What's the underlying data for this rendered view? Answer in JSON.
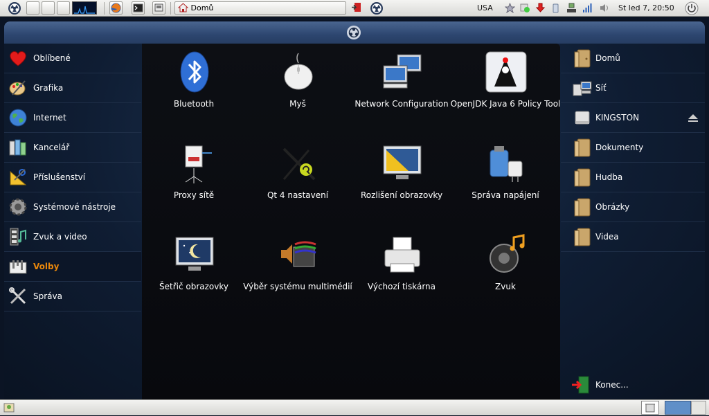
{
  "top_panel": {
    "taskbar_window": "Domů",
    "keyboard_layout": "USA",
    "clock": "St led  7, 20:50"
  },
  "categories": [
    {
      "label": "Oblíbené",
      "icon": "heart-icon"
    },
    {
      "label": "Grafika",
      "icon": "palette-icon"
    },
    {
      "label": "Internet",
      "icon": "globe-icon"
    },
    {
      "label": "Kancelář",
      "icon": "office-icon"
    },
    {
      "label": "Příslušenství",
      "icon": "accessories-icon"
    },
    {
      "label": "Systémové nástroje",
      "icon": "gear-icon"
    },
    {
      "label": "Zvuk a video",
      "icon": "multimedia-icon"
    },
    {
      "label": "Volby",
      "icon": "preferences-icon",
      "active": true
    },
    {
      "label": "Správa",
      "icon": "tools-icon"
    }
  ],
  "apps": [
    {
      "label": "Bluetooth",
      "icon": "bluetooth-icon"
    },
    {
      "label": "Myš",
      "icon": "mouse-icon"
    },
    {
      "label": "Network Configuration",
      "icon": "network-icon"
    },
    {
      "label": "OpenJDK Java 6 Policy Tool",
      "icon": "java-icon"
    },
    {
      "label": "Proxy sítě",
      "icon": "proxy-icon"
    },
    {
      "label": "Qt 4 nastavení",
      "icon": "qt-settings-icon"
    },
    {
      "label": "Rozlišení obrazovky",
      "icon": "display-resolution-icon"
    },
    {
      "label": "Správa napájení",
      "icon": "power-management-icon"
    },
    {
      "label": "Šetřič obrazovky",
      "icon": "screensaver-icon"
    },
    {
      "label": "Výběr systému multimédií",
      "icon": "multimedia-selector-icon"
    },
    {
      "label": "Výchozí tiskárna",
      "icon": "printer-icon"
    },
    {
      "label": "Zvuk",
      "icon": "sound-icon"
    }
  ],
  "places": [
    {
      "label": "Domů",
      "icon": "home-folder-icon"
    },
    {
      "label": "Síť",
      "icon": "network-places-icon"
    },
    {
      "label": "KINGSTON",
      "icon": "drive-icon",
      "eject": true
    },
    {
      "label": "Dokumenty",
      "icon": "folder-icon"
    },
    {
      "label": "Hudba",
      "icon": "folder-icon"
    },
    {
      "label": "Obrázky",
      "icon": "folder-icon"
    },
    {
      "label": "Videa",
      "icon": "folder-icon"
    }
  ],
  "logout_label": "Konec..."
}
